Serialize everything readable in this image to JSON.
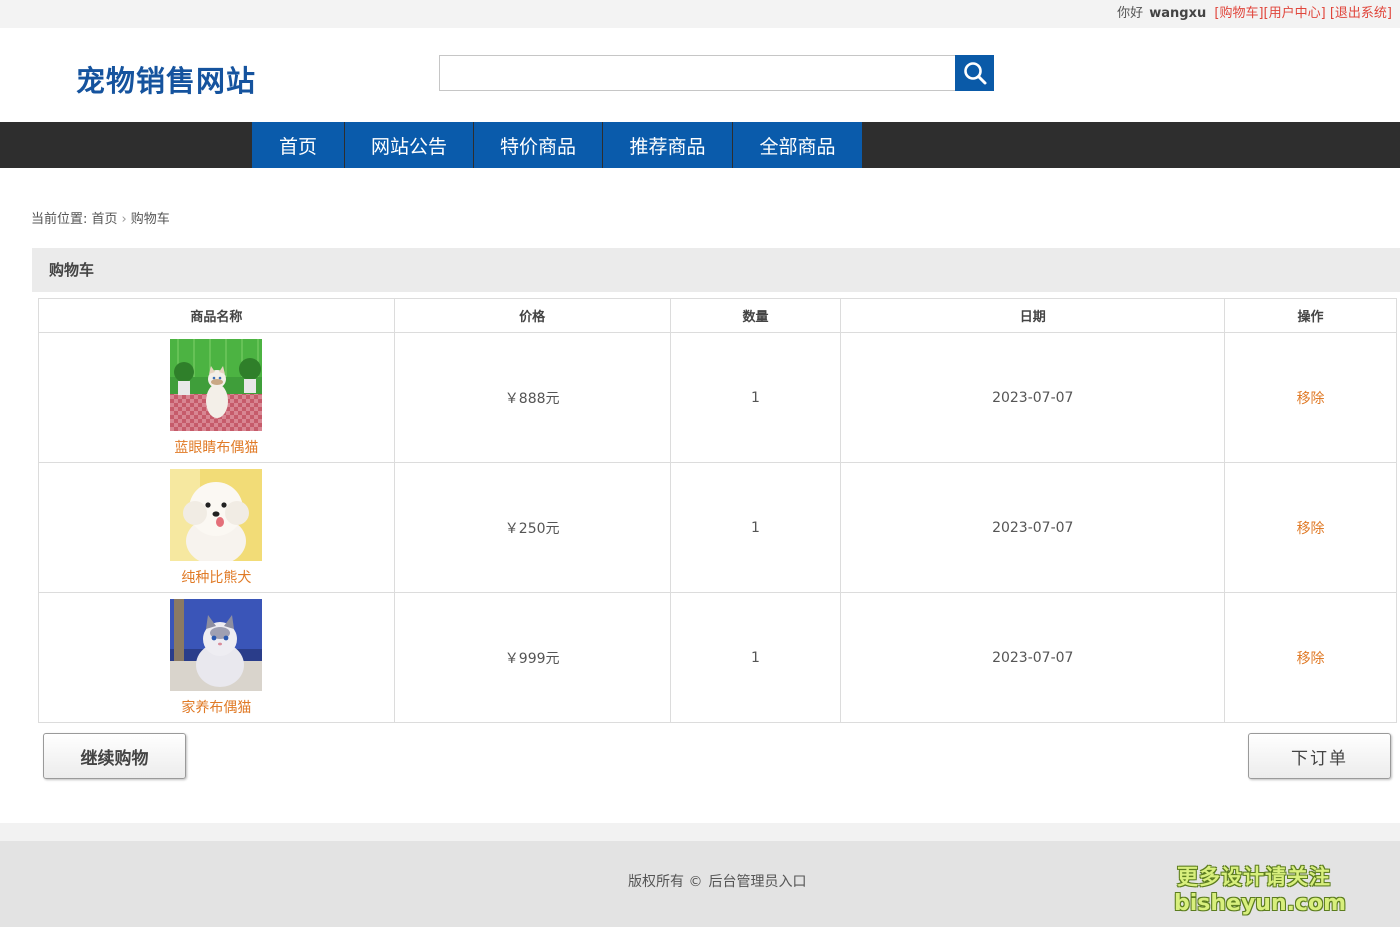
{
  "topbar": {
    "greeting": "你好",
    "username": "wangxu",
    "links": [
      "[购物车]",
      "[用户中心]",
      "[退出系统]"
    ]
  },
  "header": {
    "logo_text": "宠物销售网站",
    "search_value": "",
    "search_icon": "search-icon"
  },
  "nav": {
    "items": [
      "首页",
      "网站公告",
      "特价商品",
      "推荐商品",
      "全部商品"
    ]
  },
  "breadcrumb": {
    "prefix": "当前位置:",
    "home": "首页",
    "current": "购物车"
  },
  "cart": {
    "title": "购物车",
    "columns": [
      "商品名称",
      "价格",
      "数量",
      "日期",
      "操作"
    ],
    "rows": [
      {
        "name": "蓝眼睛布偶猫",
        "price": "￥888元",
        "qty": "1",
        "date": "2023-07-07",
        "action": "移除"
      },
      {
        "name": "纯种比熊犬",
        "price": "￥250元",
        "qty": "1",
        "date": "2023-07-07",
        "action": "移除"
      },
      {
        "name": "家养布偶猫",
        "price": "￥999元",
        "qty": "1",
        "date": "2023-07-07",
        "action": "移除"
      }
    ],
    "continue_label": "继续购物",
    "order_label": "下订单"
  },
  "footer": {
    "copyright": "版权所有 ©",
    "admin_link": "后台管理员入口"
  },
  "watermark": {
    "line1": "更多设计请关注",
    "line2": "bisheyun.com"
  },
  "colors": {
    "brand_blue": "#0a5bab",
    "nav_bg": "#2e2e2e",
    "link_orange": "#e07a26",
    "top_link_red": "#e0463c"
  }
}
